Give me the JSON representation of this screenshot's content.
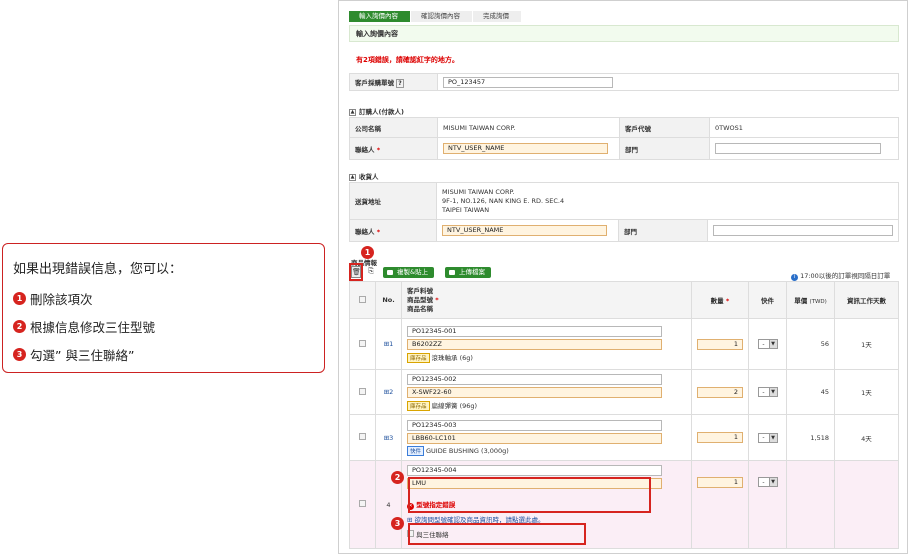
{
  "annotation": {
    "title": "如果出現錯誤信息，您可以：",
    "items": [
      {
        "num": "1",
        "text": "刪除該項次"
      },
      {
        "num": "2",
        "text": "根據信息修改三住型號"
      },
      {
        "num": "3",
        "text": "勾選” 與三住聯絡”"
      }
    ]
  },
  "breadcrumb": [
    "輸入詢價內容",
    "確認詢價內容",
    "完成詢價"
  ],
  "section_title": "輸入詢價內容",
  "error_summary": "有2項錯誤，請確認紅字的地方。",
  "po": {
    "label": "客戶採購單號",
    "value": "PO_123457"
  },
  "orderer": {
    "title": "訂購人(付款人)",
    "company_label": "公司名稱",
    "company": "MISUMI TAIWAN CORP.",
    "code_label": "客戶代號",
    "code": "0TWOS1",
    "contact_label": "聯絡人",
    "contact": "NTV_USER_NAME",
    "dept_label": "部門",
    "dept": ""
  },
  "receiver": {
    "title": "收貨人",
    "addr_label": "送貨地址",
    "addr_lines": [
      "MISUMI TAIWAN CORP.",
      "9F-1, NO.126,  NAN KING E. RD. SEC.4",
      "TAIPEI  TAIWAN"
    ],
    "contact_label": "聯絡人",
    "contact": "NTV_USER_NAME",
    "dept_label": "部門",
    "dept": ""
  },
  "products": {
    "title": "商品情報",
    "copy_button": "複製&貼上",
    "upload_button": "上傳檔案",
    "notice": "17:00以後的訂單視同隔日訂單",
    "headers": {
      "no": "No.",
      "part_l1": "客戶料號",
      "part_l2": "商品型號",
      "part_l3": "商品名稱",
      "qty": "數量",
      "express": "快件",
      "price": "單價",
      "price_unit": "(TWD)",
      "days": "資訊工作天數"
    },
    "rows": [
      {
        "no": "1",
        "part": "PO12345-001",
        "model": "B6202ZZ",
        "tag": "庫存品",
        "name": "滾珠軸承",
        "weight": "(6g)",
        "qty": "1",
        "express": "-",
        "price": "56",
        "days": "1天"
      },
      {
        "no": "2",
        "part": "PO12345-002",
        "model": "X-SWF22-60",
        "tag": "庫存品",
        "name": "扁線彈簧",
        "weight": "(96g)",
        "qty": "2",
        "express": "-",
        "price": "45",
        "days": "1天"
      },
      {
        "no": "3",
        "part": "PO12345-003",
        "model": "LBB60-LC101",
        "tag": "快件",
        "name": "GUIDE BUSHING",
        "weight": "(3,000g)",
        "qty": "1",
        "express": "-",
        "price": "1,518",
        "days": "4天"
      },
      {
        "no": "4",
        "part": "PO12345-004",
        "model": "LMU",
        "tag": "",
        "name": "",
        "weight": "",
        "qty": "1",
        "express": "-",
        "price": "",
        "days": ""
      }
    ],
    "error_title": "型號指定錯誤",
    "error_link": "欲詢問型號確認及商品資訊時，請點選此處。",
    "contact_checkbox": "與三住聯絡",
    "markers": [
      "1",
      "2",
      "3"
    ]
  },
  "colors": {
    "accent_red": "#d6241f",
    "green": "#2e8b2e"
  }
}
